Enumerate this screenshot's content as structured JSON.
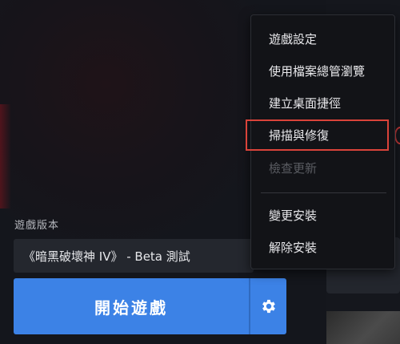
{
  "version": {
    "label": "遊戲版本",
    "selected": "《暗黑破壞神 IV》 - Beta 測試"
  },
  "play": {
    "label": "開始遊戲"
  },
  "settings_icon": "gear-icon",
  "menu": {
    "items": [
      {
        "label": "遊戲設定",
        "enabled": true
      },
      {
        "label": "使用檔案總管瀏覽",
        "enabled": true
      },
      {
        "label": "建立桌面捷徑",
        "enabled": true
      },
      {
        "label": "掃描與修復",
        "enabled": true,
        "highlighted": true
      },
      {
        "label": "檢查更新",
        "enabled": false
      },
      {
        "label": "變更安裝",
        "enabled": true
      },
      {
        "label": "解除安裝",
        "enabled": true
      }
    ]
  },
  "colors": {
    "accent": "#3c82e6",
    "highlight": "#d9433a",
    "background": "#14161c"
  }
}
